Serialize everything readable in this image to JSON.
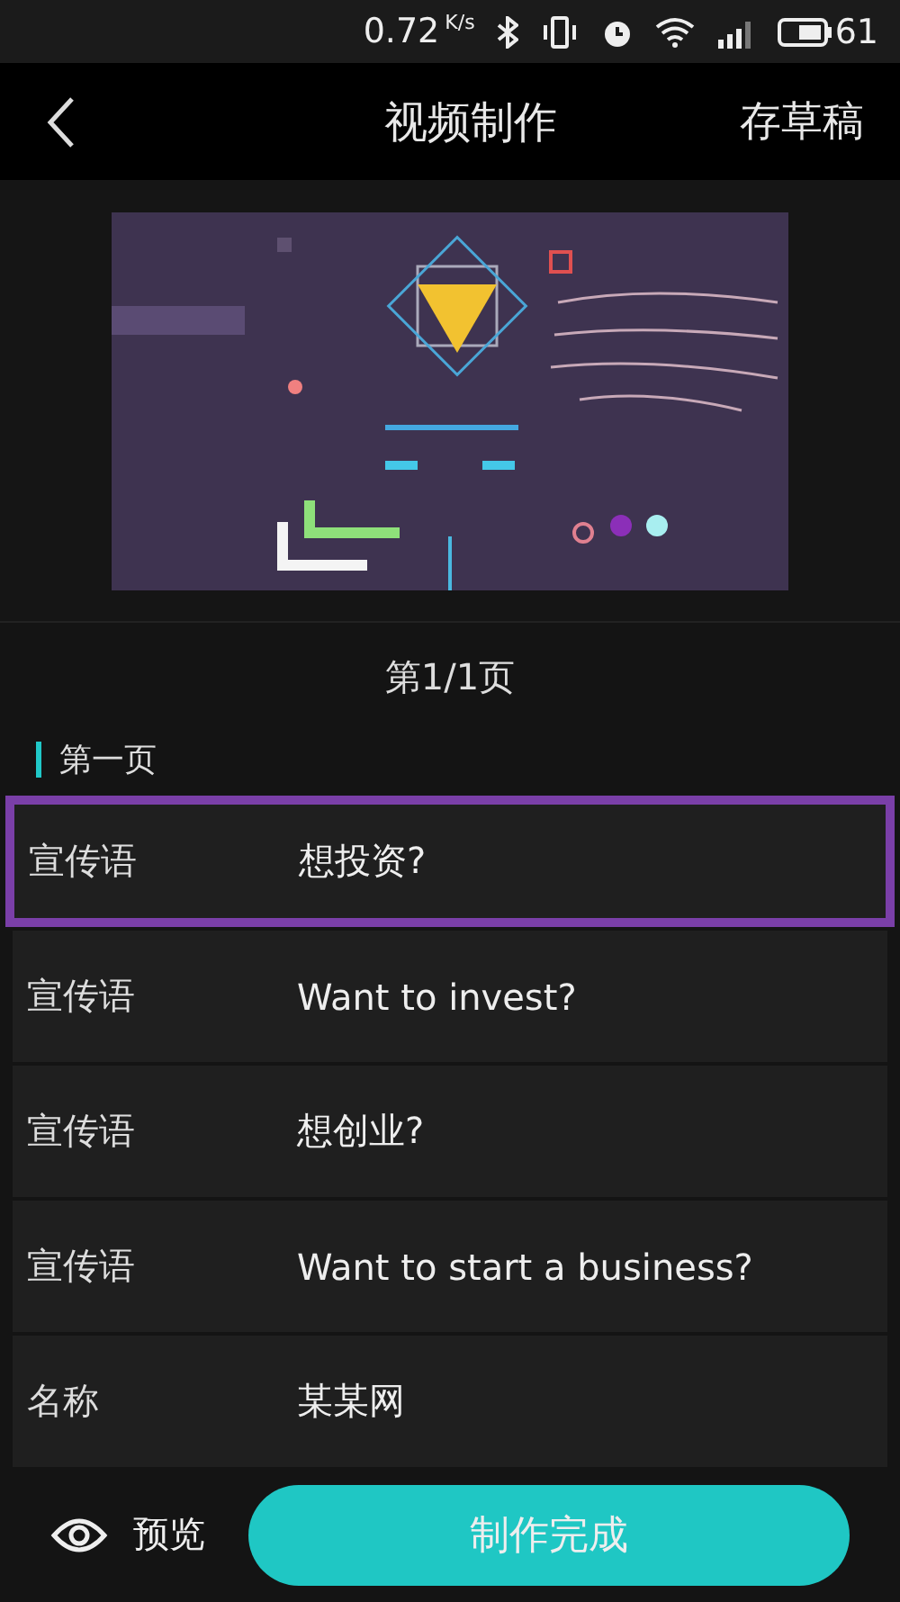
{
  "status_bar": {
    "speed": "0.72",
    "speed_unit": "K/s",
    "battery": "61"
  },
  "header": {
    "title": "视频制作",
    "action": "存草稿"
  },
  "page_indicator": "第1/1页",
  "section": {
    "title": "第一页"
  },
  "rows": [
    {
      "label": "宣传语",
      "value": "想投资?",
      "selected": true
    },
    {
      "label": "宣传语",
      "value": "Want to invest?",
      "selected": false
    },
    {
      "label": "宣传语",
      "value": "想创业?",
      "selected": false
    },
    {
      "label": "宣传语",
      "value": "Want to start a business?",
      "selected": false
    },
    {
      "label": "名称",
      "value": "某某网",
      "selected": false
    }
  ],
  "bottom_bar": {
    "preview_label": "预览",
    "done_label": "制作完成"
  }
}
